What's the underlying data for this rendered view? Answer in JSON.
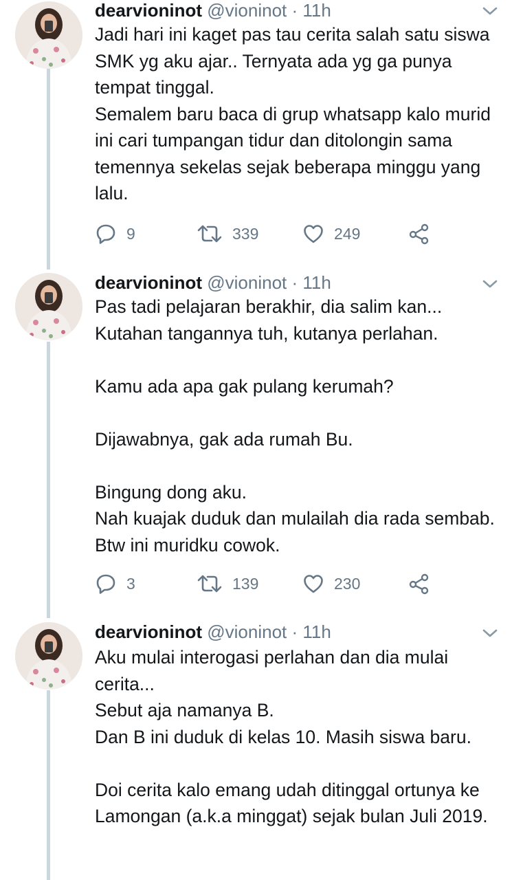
{
  "tweets": [
    {
      "name": "dearvioninot",
      "handle": "@vioninot",
      "separator": "·",
      "time": "11h",
      "lines": [
        "Jadi hari ini kaget pas tau cerita salah satu siswa SMK yg aku ajar.. Ternyata ada yg ga punya tempat tinggal.",
        "Semalem baru baca di grup whatsapp kalo murid ini cari tumpangan tidur dan ditolongin sama temennya sekelas sejak beberapa minggu yang lalu."
      ],
      "replies": "9",
      "retweets": "339",
      "likes": "249"
    },
    {
      "name": "dearvioninot",
      "handle": "@vioninot",
      "separator": "·",
      "time": "11h",
      "lines": [
        "Pas tadi pelajaran berakhir, dia salim kan...",
        "Kutahan tangannya tuh, kutanya perlahan.",
        "Kamu ada apa gak pulang kerumah?",
        "Dijawabnya, gak ada rumah Bu.",
        "Bingung dong aku.",
        "Nah kuajak duduk dan mulailah dia rada sembab. Btw ini muridku cowok."
      ],
      "replies": "3",
      "retweets": "139",
      "likes": "230"
    },
    {
      "name": "dearvioninot",
      "handle": "@vioninot",
      "separator": "·",
      "time": "11h",
      "lines": [
        "Aku mulai interogasi perlahan dan dia mulai cerita...",
        "Sebut aja namanya B.",
        "Dan B ini duduk di kelas 10. Masih siswa baru.",
        "Doi cerita kalo emang udah ditinggal ortunya ke Lamongan (a.k.a minggat) sejak bulan Juli 2019."
      ]
    }
  ],
  "icons": {
    "reply": "reply-icon",
    "retweet": "retweet-icon",
    "like": "heart-icon",
    "share": "share-icon",
    "menu": "chevron-down-icon"
  },
  "colors": {
    "text": "#14171a",
    "secondary": "#657786",
    "thread_line": "#ccd6dd"
  }
}
